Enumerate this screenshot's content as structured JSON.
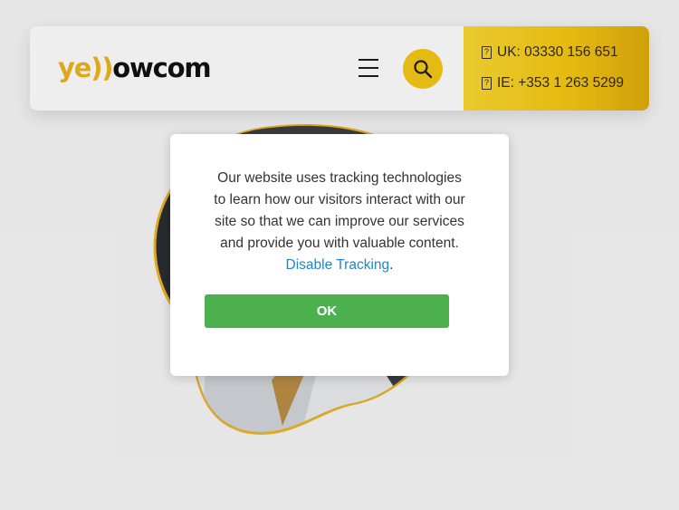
{
  "header": {
    "logo": {
      "part1": "ye",
      "part2": "))",
      "part3": "ow",
      "part4": "com"
    },
    "menu_icon": "hamburger-menu-icon",
    "search_icon": "magnifier-icon",
    "contact": {
      "uk": "UK: 03330 156 651",
      "ie": "IE: +353 1 263 5299",
      "phone_icon": "phone-icon"
    }
  },
  "cookie_dialog": {
    "line1": "Our website uses tracking technologies",
    "line2": "to learn how our visitors interact with our",
    "line3": "site so that we can improve our services",
    "line4": "and provide you with valuable content.",
    "link": "Disable Tracking",
    "link_suffix": ".",
    "button": "OK"
  },
  "colors": {
    "brand_yellow": "#f2c414",
    "ok_green": "#4cb04f",
    "link_blue": "#1f86c9"
  }
}
